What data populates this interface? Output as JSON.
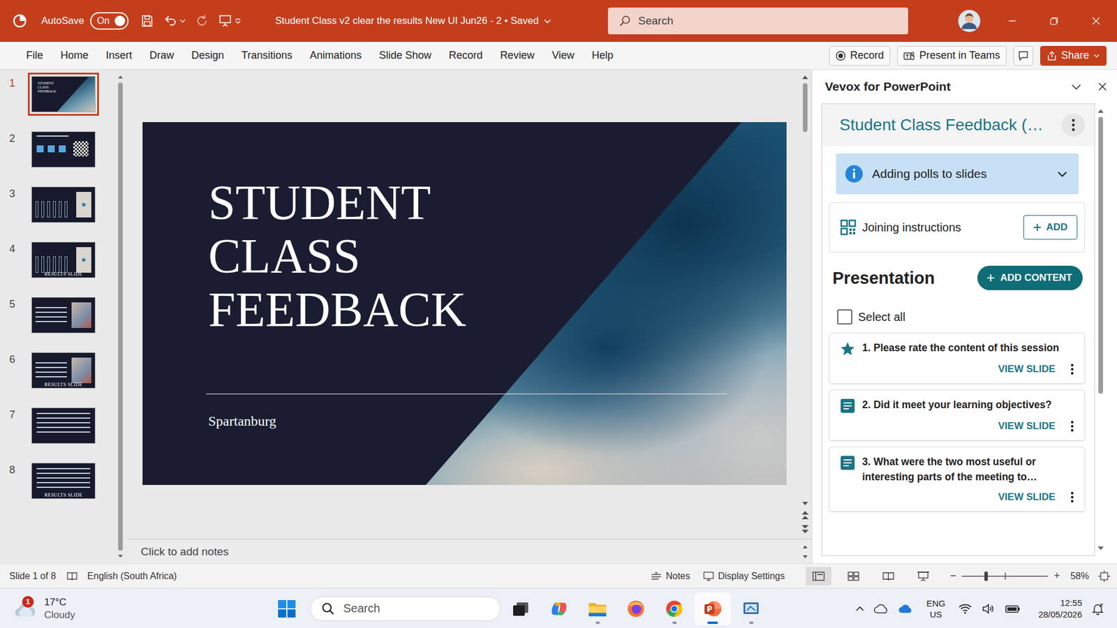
{
  "window": {
    "title": "Student Class v2 clear the results New UI Jun26 - 2 • Saved",
    "autosave": {
      "label": "AutoSave",
      "state": "On",
      "on": true
    },
    "search": {
      "placeholder": "Search"
    }
  },
  "ribbon": {
    "tabs": [
      "File",
      "Home",
      "Insert",
      "Draw",
      "Design",
      "Transitions",
      "Animations",
      "Slide Show",
      "Record",
      "Review",
      "View",
      "Help"
    ],
    "actions": [
      {
        "kind": "record",
        "label": "Record"
      },
      {
        "kind": "teams",
        "label": "Present in Teams"
      },
      {
        "kind": "comment",
        "label": ""
      },
      {
        "kind": "share",
        "label": "Share"
      }
    ]
  },
  "thumbnails": [
    {
      "number": "1",
      "selected": true,
      "kind": "title",
      "mini_title": "STUDENT CLASS FEEDBACK",
      "caption": ""
    },
    {
      "number": "2",
      "selected": false,
      "kind": "join",
      "mini_title": "",
      "caption": ""
    },
    {
      "number": "3",
      "selected": false,
      "kind": "rating",
      "mini_title": "",
      "caption": ""
    },
    {
      "number": "4",
      "selected": false,
      "kind": "rating",
      "mini_title": "",
      "caption": "RESULTS SLIDE"
    },
    {
      "number": "5",
      "selected": false,
      "kind": "objectives",
      "mini_title": "",
      "caption": ""
    },
    {
      "number": "6",
      "selected": false,
      "kind": "objectives",
      "mini_title": "",
      "caption": "RESULTS SLIDE"
    },
    {
      "number": "7",
      "selected": false,
      "kind": "list",
      "mini_title": "",
      "caption": ""
    },
    {
      "number": "8",
      "selected": false,
      "kind": "list",
      "mini_title": "",
      "caption": "RESULTS SLIDE"
    }
  ],
  "slide": {
    "title_lines": [
      "STUDENT",
      "CLASS",
      "FEEDBACK"
    ],
    "subtitle": "Spartanburg"
  },
  "notes": {
    "placeholder": "Click to add notes"
  },
  "vevox": {
    "title": "Vevox for PowerPoint",
    "presentation_name": "Student Class Feedback (…",
    "info": {
      "label": "Adding polls to slides",
      "expanded": false
    },
    "joining": {
      "label": "Joining instructions",
      "button": "ADD"
    },
    "section": {
      "title": "Presentation",
      "button": "ADD CONTENT"
    },
    "select_all": {
      "label": "Select all",
      "checked": false
    },
    "polls": [
      {
        "title": "1. Please rate the content of this session",
        "kind": "star",
        "action": "VIEW SLIDE"
      },
      {
        "title": "2. Did it meet your learning objectives?",
        "kind": "text",
        "action": "VIEW SLIDE"
      },
      {
        "title": "3. What were the two most useful or interesting parts of the meeting to…",
        "kind": "text",
        "action": "VIEW SLIDE"
      }
    ]
  },
  "status_bar": {
    "slide": "Slide 1 of 8",
    "language": "English (South Africa)",
    "notes": "Notes",
    "display": "Display Settings",
    "views": [
      {
        "kind": "normal",
        "selected": true
      },
      {
        "kind": "sorter",
        "selected": false
      },
      {
        "kind": "reading",
        "selected": false
      },
      {
        "kind": "show",
        "selected": false
      }
    ],
    "zoom": {
      "minus": "−",
      "plus": "+",
      "level": 0.28,
      "reading": "58%"
    }
  },
  "taskbar": {
    "weather": {
      "temp": "17°C",
      "condition": "Cloudy",
      "badge": "1"
    },
    "search": {
      "placeholder": "Search"
    },
    "apps": [
      {
        "kind": "taskview",
        "running": false,
        "active": false
      },
      {
        "kind": "copilot",
        "running": false,
        "active": false
      },
      {
        "kind": "explorer",
        "running": true,
        "active": false
      },
      {
        "kind": "firefox",
        "running": false,
        "active": false
      },
      {
        "kind": "chrome",
        "running": true,
        "active": false
      },
      {
        "kind": "powerpoint",
        "running": true,
        "active": true
      },
      {
        "kind": "snip",
        "running": true,
        "active": false
      }
    ],
    "tray": {
      "lang": "ENG",
      "region": "US",
      "time": "12:55",
      "date": "28/05/2026"
    }
  }
}
